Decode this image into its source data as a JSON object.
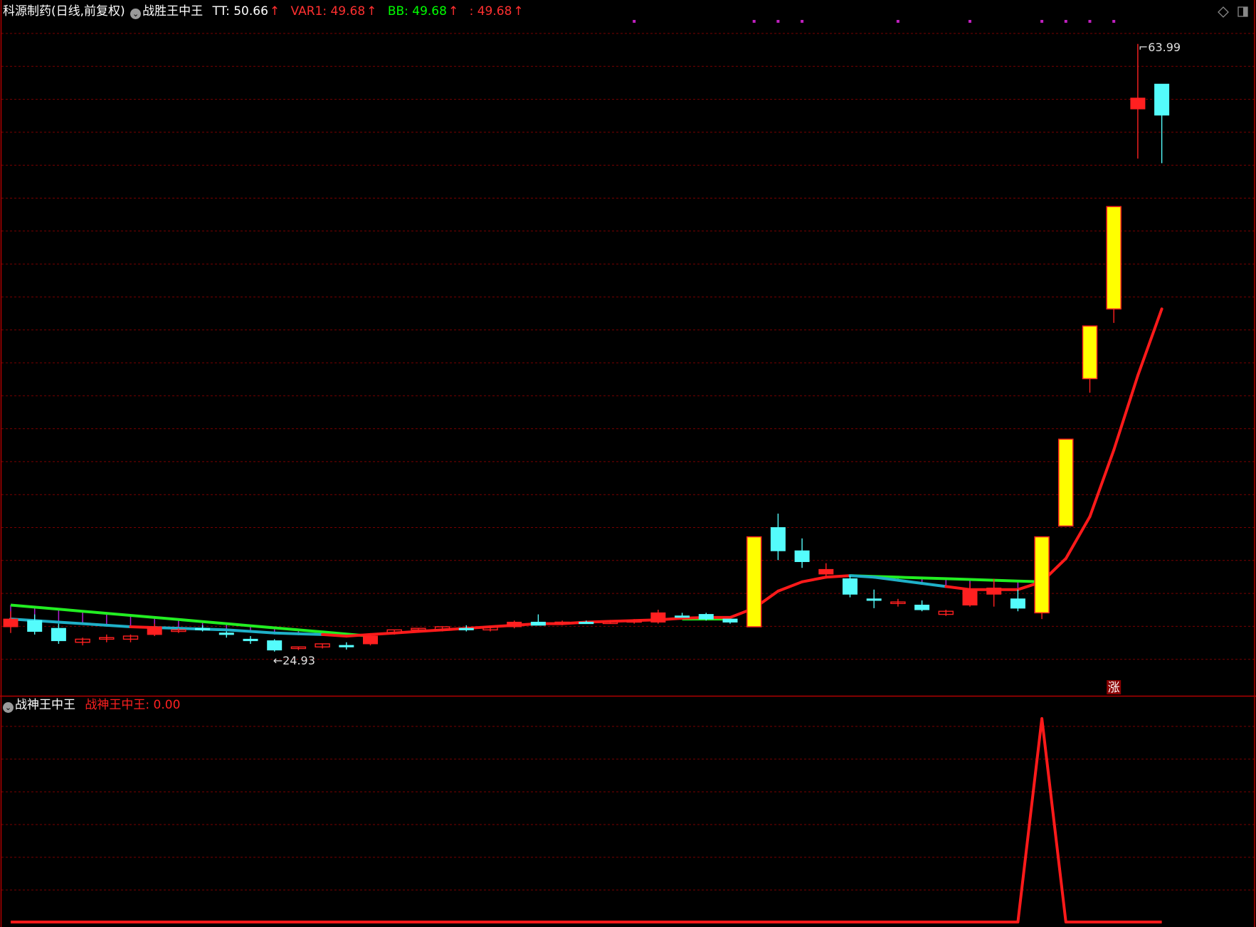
{
  "header": {
    "stock_title": "科源制药(日线,前复权)",
    "indicator_name": "战胜王中王",
    "items": [
      {
        "label": "TT: 50.66",
        "color": "#ffffff"
      },
      {
        "label": "VAR1: 49.68",
        "color": "#ff3030"
      },
      {
        "label": "BB: 49.68",
        "color": "#00ff00"
      },
      {
        "label": ": 49.68",
        "color": "#ff3030"
      }
    ],
    "arrow": "↑"
  },
  "sub_header": {
    "indicator_name": "战神王中王",
    "value_label": "战神王中王: 0.00"
  },
  "colors": {
    "background": "#000000",
    "grid": "#7a0000",
    "axis_line": "#b00000",
    "up_candle": "#ff2020",
    "down_candle": "#54fcfc",
    "signal_candle": "#ffff00",
    "ma_rising": "#ff1a1a",
    "ma_falling": "#1fb0c8",
    "resistance": "#22ee22",
    "stick": "#b020d0",
    "dots": "#c020c0"
  },
  "chart_data": [
    {
      "type": "candlestick",
      "title": "战胜王中王",
      "ylim": [
        22.5,
        66
      ],
      "max_label": "63.99",
      "min_label": "24.93",
      "signal_text": "涨",
      "candles": [
        {
          "o": 26.9,
          "h": 27.4,
          "c": 26.4,
          "l": 26.0,
          "k": "up"
        },
        {
          "o": 26.8,
          "h": 27.2,
          "c": 26.1,
          "l": 25.9,
          "k": "down"
        },
        {
          "o": 26.3,
          "h": 26.6,
          "c": 25.5,
          "l": 25.3,
          "k": "down"
        },
        {
          "o": 25.4,
          "h": 25.7,
          "c": 25.6,
          "l": 25.2,
          "k": "up"
        },
        {
          "o": 25.6,
          "h": 25.9,
          "c": 25.7,
          "l": 25.4,
          "k": "up"
        },
        {
          "o": 25.6,
          "h": 25.9,
          "c": 25.8,
          "l": 25.4,
          "k": "up"
        },
        {
          "o": 25.9,
          "h": 26.6,
          "c": 26.4,
          "l": 25.8,
          "k": "up"
        },
        {
          "o": 26.1,
          "h": 26.3,
          "c": 26.2,
          "l": 26.0,
          "k": "up"
        },
        {
          "o": 26.3,
          "h": 26.5,
          "c": 26.2,
          "l": 26.1,
          "k": "down"
        },
        {
          "o": 26.0,
          "h": 26.1,
          "c": 25.9,
          "l": 25.7,
          "k": "down"
        },
        {
          "o": 25.6,
          "h": 25.8,
          "c": 25.5,
          "l": 25.3,
          "k": "down"
        },
        {
          "o": 25.5,
          "h": 25.6,
          "c": 24.9,
          "l": 24.8,
          "k": "down"
        },
        {
          "o": 25.0,
          "h": 25.1,
          "c": 25.1,
          "l": 24.9,
          "k": "up"
        },
        {
          "o": 25.1,
          "h": 25.3,
          "c": 25.3,
          "l": 25.0,
          "k": "up"
        },
        {
          "o": 25.2,
          "h": 25.4,
          "c": 25.1,
          "l": 24.93,
          "k": "down"
        },
        {
          "o": 25.3,
          "h": 25.9,
          "c": 25.8,
          "l": 25.2,
          "k": "up"
        },
        {
          "o": 26.0,
          "h": 26.2,
          "c": 26.2,
          "l": 25.9,
          "k": "up"
        },
        {
          "o": 26.2,
          "h": 26.3,
          "c": 26.3,
          "l": 26.1,
          "k": "up"
        },
        {
          "o": 26.2,
          "h": 26.4,
          "c": 26.4,
          "l": 26.1,
          "k": "up"
        },
        {
          "o": 26.3,
          "h": 26.5,
          "c": 26.2,
          "l": 26.1,
          "k": "down"
        },
        {
          "o": 26.2,
          "h": 26.4,
          "c": 26.4,
          "l": 26.1,
          "k": "up"
        },
        {
          "o": 26.4,
          "h": 26.8,
          "c": 26.7,
          "l": 26.3,
          "k": "up"
        },
        {
          "o": 26.7,
          "h": 27.2,
          "c": 26.5,
          "l": 26.5,
          "k": "down"
        },
        {
          "o": 26.7,
          "h": 26.8,
          "c": 26.7,
          "l": 26.5,
          "k": "up"
        },
        {
          "o": 26.7,
          "h": 26.8,
          "c": 26.6,
          "l": 26.6,
          "k": "down"
        },
        {
          "o": 26.7,
          "h": 26.8,
          "c": 26.7,
          "l": 26.6,
          "k": "up"
        },
        {
          "o": 26.7,
          "h": 26.8,
          "c": 26.8,
          "l": 26.6,
          "k": "up"
        },
        {
          "o": 26.7,
          "h": 27.5,
          "c": 27.3,
          "l": 26.6,
          "k": "up"
        },
        {
          "o": 27.1,
          "h": 27.3,
          "c": 27.1,
          "l": 27.0,
          "k": "down"
        },
        {
          "o": 27.2,
          "h": 27.3,
          "c": 26.9,
          "l": 26.8,
          "k": "down"
        },
        {
          "o": 26.9,
          "h": 26.9,
          "c": 26.7,
          "l": 26.6,
          "k": "down"
        },
        {
          "o": 26.4,
          "h": 32.2,
          "c": 32.2,
          "l": 26.4,
          "k": "signal"
        },
        {
          "o": 32.8,
          "h": 33.7,
          "c": 31.3,
          "l": 30.7,
          "k": "down"
        },
        {
          "o": 31.3,
          "h": 32.1,
          "c": 30.6,
          "l": 30.2,
          "k": "down"
        },
        {
          "o": 30.1,
          "h": 30.5,
          "c": 29.8,
          "l": 29.6,
          "k": "up"
        },
        {
          "o": 29.5,
          "h": 29.7,
          "c": 28.5,
          "l": 28.3,
          "k": "down"
        },
        {
          "o": 28.2,
          "h": 28.8,
          "c": 28.1,
          "l": 27.6,
          "k": "down"
        },
        {
          "o": 28.0,
          "h": 28.2,
          "c": 27.9,
          "l": 27.7,
          "k": "up"
        },
        {
          "o": 27.8,
          "h": 28.1,
          "c": 27.5,
          "l": 27.4,
          "k": "down"
        },
        {
          "o": 27.2,
          "h": 27.5,
          "c": 27.4,
          "l": 27.1,
          "k": "up"
        },
        {
          "o": 27.8,
          "h": 29.2,
          "c": 28.8,
          "l": 27.7,
          "k": "up"
        },
        {
          "o": 28.5,
          "h": 29.5,
          "c": 28.9,
          "l": 27.7,
          "k": "up"
        },
        {
          "o": 28.2,
          "h": 28.8,
          "c": 27.6,
          "l": 27.4,
          "k": "down"
        },
        {
          "o": 27.3,
          "h": 32.2,
          "c": 32.2,
          "l": 26.9,
          "k": "signal"
        },
        {
          "o": 32.9,
          "h": 38.5,
          "c": 38.5,
          "l": 32.9,
          "k": "signal"
        },
        {
          "o": 42.4,
          "h": 45.8,
          "c": 45.8,
          "l": 41.5,
          "k": "signal"
        },
        {
          "o": 46.9,
          "h": 53.5,
          "c": 53.5,
          "l": 46.0,
          "k": "signal"
        },
        {
          "o": 59.8,
          "h": 63.99,
          "c": 60.5,
          "l": 56.6,
          "k": "up"
        },
        {
          "o": 61.4,
          "h": 61.4,
          "c": 59.4,
          "l": 56.3,
          "k": "down"
        }
      ],
      "ma": [
        26.9,
        26.8,
        26.7,
        26.6,
        26.5,
        26.4,
        26.35,
        26.3,
        26.25,
        26.2,
        26.1,
        26.0,
        25.95,
        25.9,
        25.8,
        25.9,
        26.0,
        26.1,
        26.2,
        26.3,
        26.4,
        26.5,
        26.6,
        26.6,
        26.7,
        26.75,
        26.8,
        26.85,
        26.95,
        27.0,
        27.0,
        27.6,
        28.7,
        29.3,
        29.6,
        29.7,
        29.6,
        29.4,
        29.2,
        29.0,
        28.8,
        28.8,
        28.8,
        29.3,
        30.8,
        33.5,
        37.8,
        42.6,
        46.9
      ],
      "ma_trend": [
        "f",
        "f",
        "f",
        "f",
        "f",
        "f",
        "r",
        "f",
        "f",
        "f",
        "f",
        "f",
        "f",
        "f",
        "r",
        "r",
        "r",
        "r",
        "r",
        "r",
        "r",
        "r",
        "r",
        "r",
        "r",
        "r",
        "r",
        "r",
        "r",
        "r",
        "r",
        "r",
        "r",
        "r",
        "r",
        "r",
        "f",
        "f",
        "f",
        "f",
        "r",
        "r",
        "r",
        "r",
        "r",
        "r",
        "r",
        "r",
        "r"
      ],
      "resistance": [
        {
          "from": 0,
          "to": 15,
          "v1": 27.8,
          "v2": 25.8
        },
        {
          "from": 28,
          "to": 30,
          "v1": 26.9,
          "v2": 26.9
        },
        {
          "from": 35,
          "to": 43,
          "v1": 29.7,
          "v2": 29.3
        }
      ],
      "dot_bars": [
        26,
        31,
        32,
        33,
        37,
        40,
        43,
        44,
        45,
        46
      ]
    },
    {
      "type": "line",
      "title": "战神王中王",
      "ylim": [
        0,
        1
      ],
      "values": [
        0,
        0,
        0,
        0,
        0,
        0,
        0,
        0,
        0,
        0,
        0,
        0,
        0,
        0,
        0,
        0,
        0,
        0,
        0,
        0,
        0,
        0,
        0,
        0,
        0,
        0,
        0,
        0,
        0,
        0,
        0,
        0,
        0,
        0,
        0,
        0,
        0,
        0,
        0,
        0,
        0,
        0,
        0,
        1,
        0,
        0,
        0,
        0,
        0
      ]
    }
  ]
}
